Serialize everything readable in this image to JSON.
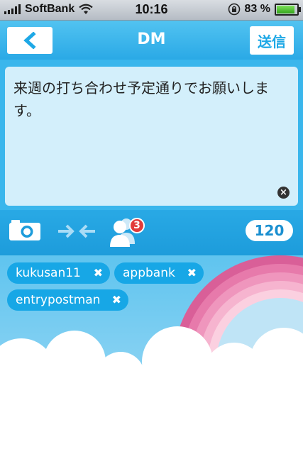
{
  "status": {
    "carrier": "SoftBank",
    "time": "10:16",
    "battery": "83 %"
  },
  "nav": {
    "title": "DM",
    "send_label": "送信"
  },
  "compose": {
    "text": "来週の打ち合わせ予定通りでお願いします。",
    "clear_icon": "close-circle-icon"
  },
  "toolbar": {
    "recipient_count": "3",
    "char_counter": "120",
    "icons": [
      "camera-icon",
      "merge-arrows-icon",
      "users-icon"
    ]
  },
  "recipients": [
    {
      "name": "kukusan11"
    },
    {
      "name": "appbank"
    },
    {
      "name": "entrypostman"
    }
  ],
  "colors": {
    "accent": "#29a9e5",
    "compose_bg": "#d3effb",
    "badge": "#e23b3b"
  }
}
